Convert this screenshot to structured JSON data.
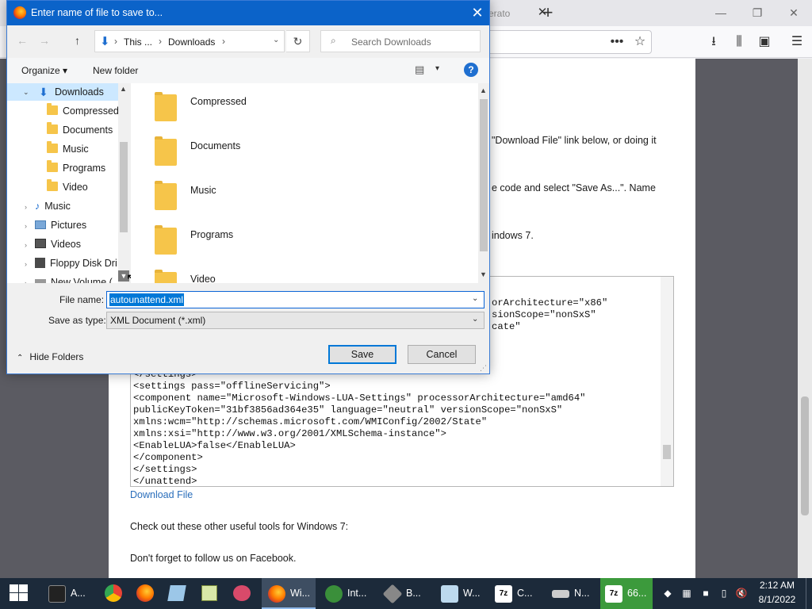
{
  "firefox": {
    "tab_title_fragment": "erato",
    "close_tab": "✕",
    "new_tab": "+",
    "page_lines": [
      "\"Download File\" link below, or doing it",
      "e code and select \"Save As...\". Name",
      "indows 7."
    ],
    "code_top_lines": [
      "orArchitecture=\"x86\"",
      "sionScope=\"nonSxS\"",
      "cate\""
    ],
    "code_lines": [
      "</settings>",
      "<settings pass=\"offlineServicing\">",
      "<component name=\"Microsoft-Windows-LUA-Settings\" processorArchitecture=\"amd64\"",
      "publicKeyToken=\"31bf3856ad364e35\" language=\"neutral\" versionScope=\"nonSxS\"",
      "xmlns:wcm=\"http://schemas.microsoft.com/WMIConfig/2002/State\"",
      "xmlns:xsi=\"http://www.w3.org/2001/XMLSchema-instance\">",
      "<EnableLUA>false</EnableLUA>",
      "</component>",
      "</settings>",
      "</unattend>"
    ],
    "download_link": "Download File",
    "other_tools": "Check out these other useful tools for Windows 7:",
    "facebook": "Don't forget to follow us on Facebook."
  },
  "dialog": {
    "title": "Enter name of file to save to...",
    "breadcrumb": [
      "This ...",
      "Downloads"
    ],
    "search_placeholder": "Search Downloads",
    "organize": "Organize",
    "new_folder": "New folder",
    "help": "?",
    "nav_tree": [
      {
        "label": "Downloads",
        "icon": "download-icon",
        "selected": true
      },
      {
        "label": "Compressed",
        "icon": "folder-icon"
      },
      {
        "label": "Documents",
        "icon": "folder-icon"
      },
      {
        "label": "Music",
        "icon": "folder-icon"
      },
      {
        "label": "Programs",
        "icon": "folder-icon"
      },
      {
        "label": "Video",
        "icon": "folder-icon"
      },
      {
        "label": "Music",
        "icon": "music-icon"
      },
      {
        "label": "Pictures",
        "icon": "pictures-icon"
      },
      {
        "label": "Videos",
        "icon": "videos-icon"
      },
      {
        "label": "Floppy Disk Dri",
        "icon": "floppy-icon"
      },
      {
        "label": "New Volume (",
        "icon": "drive-icon"
      }
    ],
    "files": [
      "Compressed",
      "Documents",
      "Music",
      "Programs",
      "Video"
    ],
    "file_name_label": "File name:",
    "file_name_value": "autounattend.xml",
    "save_type_label": "Save as type:",
    "save_type_value": "XML Document (*.xml)",
    "hide_folders": "Hide Folders",
    "save": "Save",
    "cancel": "Cancel"
  },
  "taskbar": {
    "items": [
      "A...",
      "Wi...",
      "Int...",
      "B...",
      "W...",
      "C...",
      "N...",
      "66..."
    ],
    "time": "2:12 AM",
    "date": "8/1/2022"
  }
}
